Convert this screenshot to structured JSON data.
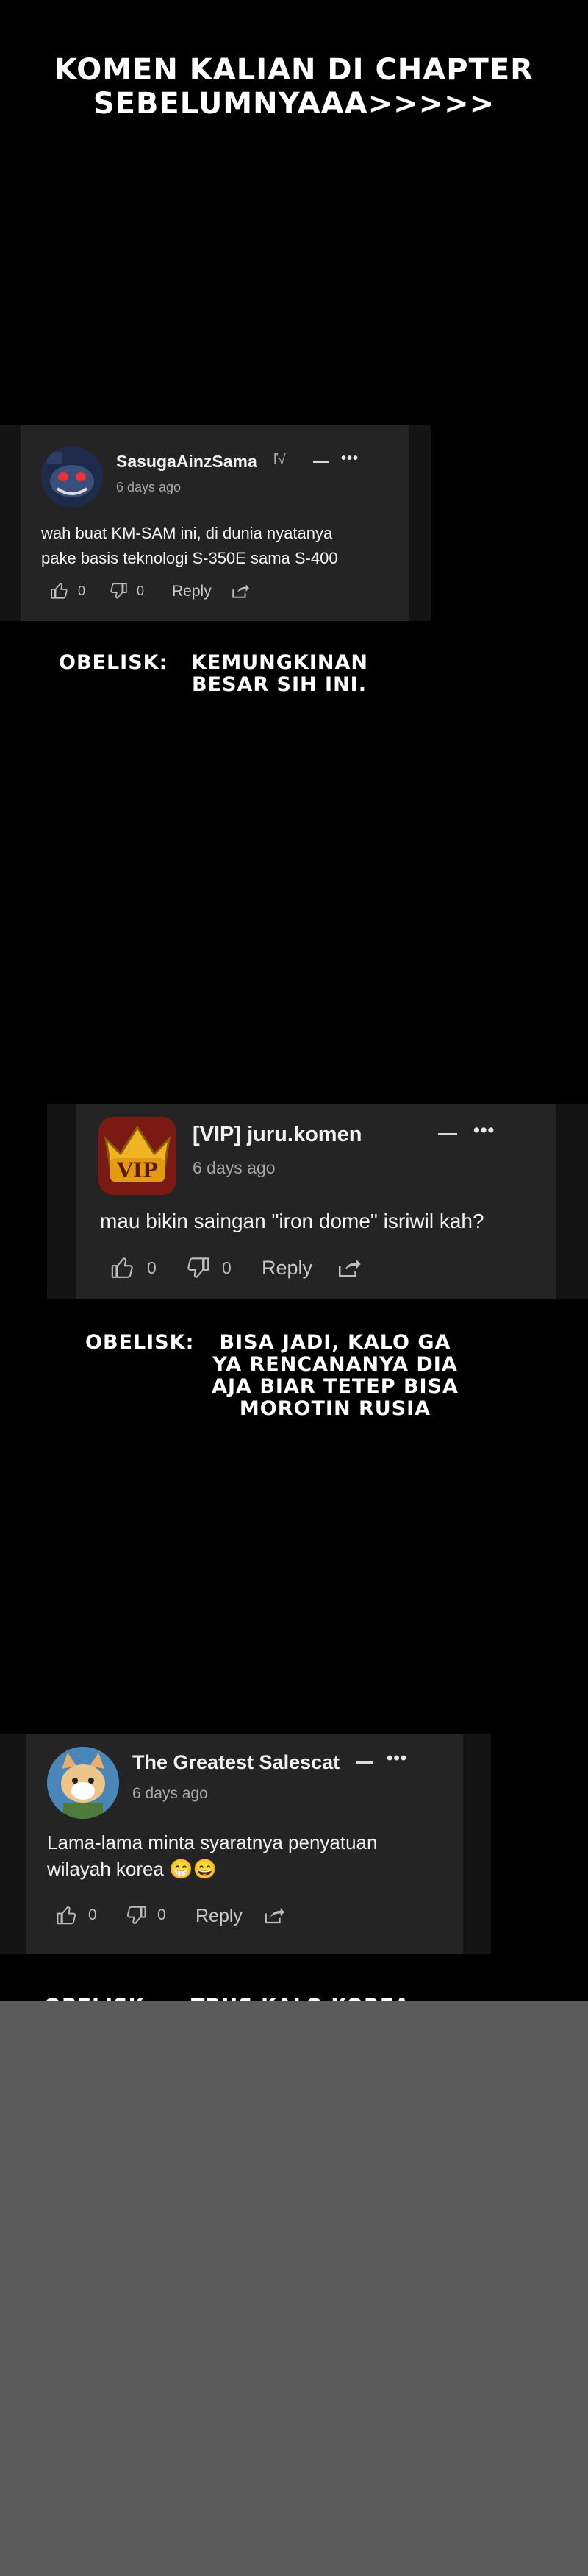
{
  "header": {
    "line1": "KOMEN KALIAN DI CHAPTER",
    "line2": "SEBELUMNYAAA>>>>>"
  },
  "comments": [
    {
      "username": "SasugaAinzSama",
      "extra_badge": "ľ√",
      "time": "6 days ago",
      "text_line1": "wah buat KM-SAM ini, di dunia nyatanya",
      "text_line2": "pake basis teknologi S-350E sama S-400",
      "likes": "0",
      "dislikes": "0",
      "reply_label": "Reply",
      "more": "•••"
    },
    {
      "username": "[VIP] juru.komen",
      "avatar_badge": "VIP",
      "time": "6 days ago",
      "text_line1": "mau bikin saingan \"iron dome\" isriwil kah?",
      "likes": "0",
      "dislikes": "0",
      "reply_label": "Reply",
      "more": "•••"
    },
    {
      "username": "The Greatest Salescat",
      "time": "6 days ago",
      "text_line1": "Lama-lama minta syaratnya penyatuan",
      "text_line2": "wilayah korea 😁😄",
      "likes": "0",
      "dislikes": "0",
      "reply_label": "Reply",
      "more": "•••"
    }
  ],
  "narrations": [
    {
      "speaker": "OBELISK:",
      "lines": [
        "KEMUNGKINAN",
        "BESAR SIH INI."
      ]
    },
    {
      "speaker": "OBELISK:",
      "lines": [
        "BISA JADI, KALO GA",
        "YA RENCANANYA DIA",
        "AJA BIAR TETEP BISA",
        "MOROTIN RUSIA"
      ]
    },
    {
      "speaker": "OBELISK:",
      "lines": [
        "TRUS KALO KOREA"
      ]
    }
  ],
  "colors": {
    "background": "#000000",
    "card": "#242424",
    "card_outer": "#141414",
    "filler": "#5b5b5b"
  },
  "icons": [
    "thumbs-up-icon",
    "thumbs-down-icon",
    "share-icon",
    "minus-icon",
    "more-icon"
  ]
}
